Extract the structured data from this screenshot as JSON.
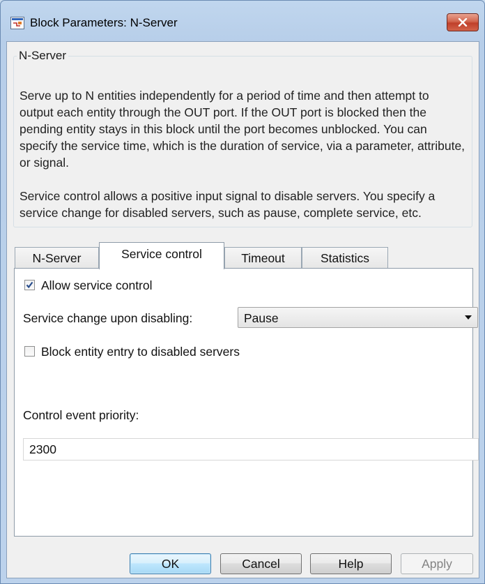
{
  "window": {
    "title": "Block Parameters: N-Server"
  },
  "group": {
    "legend": "N-Server",
    "description_p1": "Serve up to N entities independently for a period of time and then attempt to output each entity through the OUT port. If the OUT port is blocked then the pending entity stays in this block until the port becomes unblocked. You can specify the service time, which is the duration of service, via a parameter, attribute, or signal.",
    "description_p2": "Service control allows a positive input signal to disable servers. You specify a service change for disabled servers, such as pause, complete service, etc."
  },
  "tabs": [
    {
      "label": "N-Server",
      "active": false
    },
    {
      "label": "Service control",
      "active": true
    },
    {
      "label": "Timeout",
      "active": false
    },
    {
      "label": "Statistics",
      "active": false
    }
  ],
  "panel": {
    "allow_service_control": {
      "label": "Allow service control",
      "checked": true
    },
    "service_change": {
      "label": "Service change upon disabling:",
      "value": "Pause"
    },
    "block_entry": {
      "label": "Block entity entry to disabled servers",
      "checked": false
    },
    "priority": {
      "label": "Control event priority:",
      "value": "2300"
    }
  },
  "buttons": {
    "ok": "OK",
    "cancel": "Cancel",
    "help": "Help",
    "apply": "Apply"
  },
  "colors": {
    "title_bar": "#b9d1ea",
    "close_button": "#c94a32",
    "default_button_border": "#3c7fb1",
    "checkbox_check": "#2a4e8c"
  }
}
